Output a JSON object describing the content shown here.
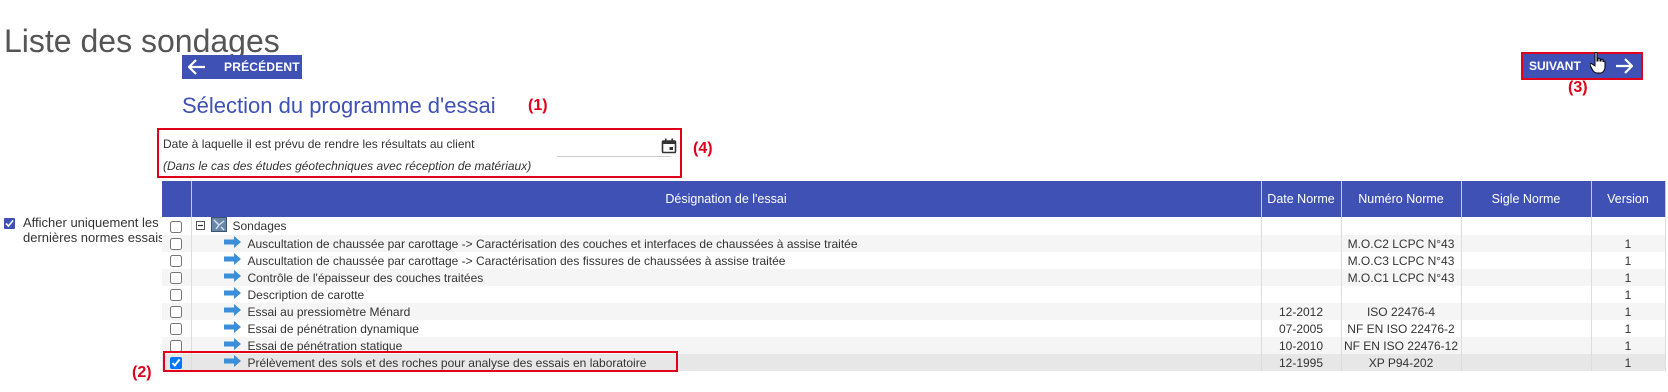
{
  "page": {
    "title": "Liste des sondages"
  },
  "nav": {
    "previous_label": "PRÉCÉDENT",
    "next_label": "SUIVANT"
  },
  "section": {
    "title": "Sélection du programme d'essai"
  },
  "date_field": {
    "label": "Date à laquelle il est prévu de rendre les résultats au client",
    "note": "(Dans le cas des études géotechniques avec réception de matériaux)",
    "value": ""
  },
  "filter": {
    "label": "Afficher uniquement les dernières normes essais",
    "checked": true
  },
  "callouts": {
    "c1": "(1)",
    "c2": "(2)",
    "c3": "(3)",
    "c4": "(4)"
  },
  "table": {
    "columns": [
      "",
      "Désignation de l'essai",
      "Date Norme",
      "Numéro Norme",
      "Sigle Norme",
      "Version"
    ],
    "root": {
      "label": "Sondages",
      "toggle": "minus-square-icon"
    },
    "rows": [
      {
        "designation": "Auscultation de chaussée par carottage -> Caractérisation des couches et interfaces de chaussées à assise traitée",
        "date": "",
        "numero": "M.O.C2 LCPC N°43",
        "sigle": "",
        "version": "1",
        "checked": false
      },
      {
        "designation": "Auscultation de chaussée par carottage -> Caractérisation des fissures de chaussées à assise traitée",
        "date": "",
        "numero": "M.O.C3 LCPC N°43",
        "sigle": "",
        "version": "1",
        "checked": false
      },
      {
        "designation": "Contrôle de l'épaisseur des couches traitées",
        "date": "",
        "numero": "M.O.C1 LCPC N°43",
        "sigle": "",
        "version": "1",
        "checked": false
      },
      {
        "designation": "Description de carotte",
        "date": "",
        "numero": "",
        "sigle": "",
        "version": "1",
        "checked": false
      },
      {
        "designation": "Essai au pressiomètre Ménard",
        "date": "12-2012",
        "numero": "ISO 22476-4",
        "sigle": "",
        "version": "1",
        "checked": false
      },
      {
        "designation": "Essai de pénétration dynamique",
        "date": "07-2005",
        "numero": "NF EN ISO 22476-2",
        "sigle": "",
        "version": "1",
        "checked": false
      },
      {
        "designation": "Essai de pénétration statique",
        "date": "10-2010",
        "numero": "NF EN ISO 22476-12",
        "sigle": "",
        "version": "1",
        "checked": false
      },
      {
        "designation": "Prélèvement des sols et des roches pour analyse des essais en laboratoire",
        "date": "12-1995",
        "numero": "XP P94-202",
        "sigle": "",
        "version": "1",
        "checked": true
      }
    ]
  },
  "colors": {
    "primary": "#3f51b5",
    "annotation": "#e0001b",
    "arrow_icon": "#3a8fd8"
  }
}
